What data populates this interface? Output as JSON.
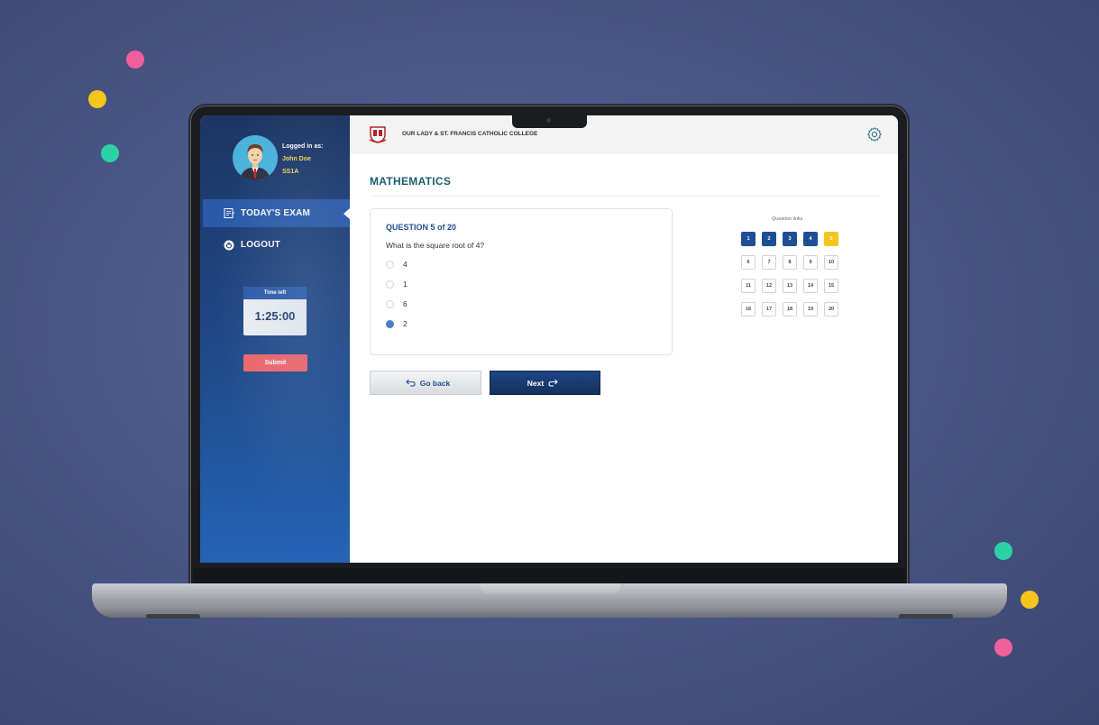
{
  "decor": {
    "dot_colors": [
      "#f0609a",
      "#f5c51c",
      "#2ed1a6"
    ]
  },
  "user": {
    "logged_in_label": "Logged in as:",
    "name": "John Doe",
    "class": "SS1A"
  },
  "nav": {
    "items": [
      {
        "label": "TODAY'S EXAM",
        "icon": "exam-icon",
        "active": true
      },
      {
        "label": "LOGOUT",
        "icon": "power-icon",
        "active": false
      }
    ]
  },
  "timer": {
    "label": "Time left",
    "value": "1:25:00"
  },
  "submit_label": "Submit",
  "header": {
    "school_name": "OUR LADY & ST. FRANCIS CATHOLIC COLLEGE",
    "crest_icon": "school-crest-icon",
    "settings_icon": "gear-icon"
  },
  "subject": "MATHEMATICS",
  "question": {
    "number_label": "QUESTION 5 of 20",
    "text": "What is the square root of 4?",
    "options": [
      {
        "label": "4",
        "selected": false
      },
      {
        "label": "1",
        "selected": false
      },
      {
        "label": "6",
        "selected": false
      },
      {
        "label": "2",
        "selected": true
      }
    ]
  },
  "buttons": {
    "back_label": "Go back",
    "next_label": "Next"
  },
  "question_links": {
    "title": "Question links",
    "items": [
      {
        "label": "1",
        "state": "done"
      },
      {
        "label": "2",
        "state": "done"
      },
      {
        "label": "3",
        "state": "done"
      },
      {
        "label": "4",
        "state": "done"
      },
      {
        "label": "5",
        "state": "current"
      },
      {
        "label": "6",
        "state": "open"
      },
      {
        "label": "7",
        "state": "open"
      },
      {
        "label": "8",
        "state": "open"
      },
      {
        "label": "9",
        "state": "open"
      },
      {
        "label": "10",
        "state": "open"
      },
      {
        "label": "11",
        "state": "open"
      },
      {
        "label": "12",
        "state": "open"
      },
      {
        "label": "13",
        "state": "open"
      },
      {
        "label": "14",
        "state": "open"
      },
      {
        "label": "15",
        "state": "open"
      },
      {
        "label": "16",
        "state": "open"
      },
      {
        "label": "17",
        "state": "open"
      },
      {
        "label": "18",
        "state": "open"
      },
      {
        "label": "19",
        "state": "open"
      },
      {
        "label": "20",
        "state": "open"
      }
    ]
  },
  "colors": {
    "primary": "#1e4f95",
    "current_question": "#f5c51c",
    "submit": "#f0646a",
    "subject": "#1b5e6e"
  }
}
